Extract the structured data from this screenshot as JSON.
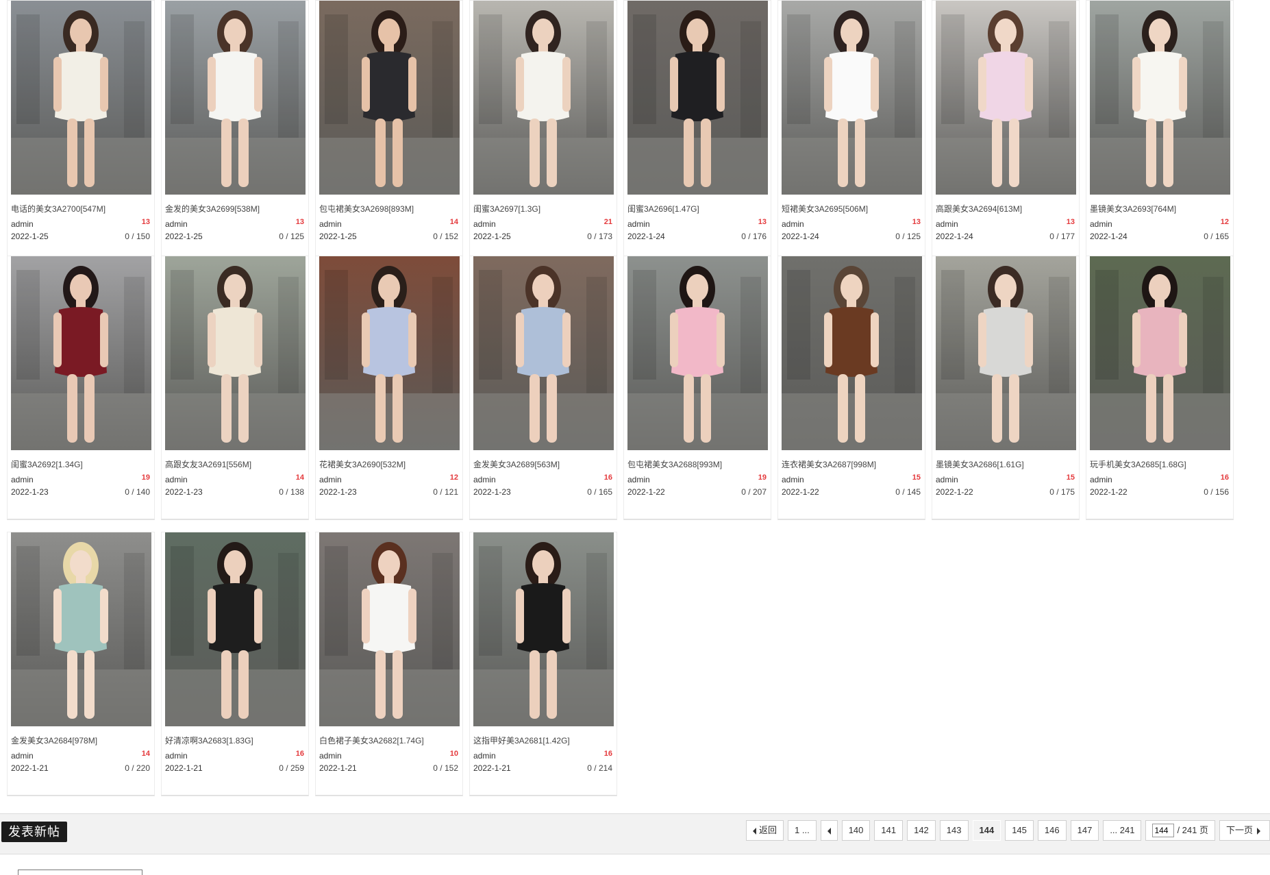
{
  "posts": [
    {
      "title": "电话的美女3A2700[547M]",
      "author": "admin",
      "replies": "13",
      "date": "2022-1-25",
      "views": "0 / 150"
    },
    {
      "title": "金发的美女3A2699[538M]",
      "author": "admin",
      "replies": "13",
      "date": "2022-1-25",
      "views": "0 / 125"
    },
    {
      "title": "包屯裙美女3A2698[893M]",
      "author": "admin",
      "replies": "14",
      "date": "2022-1-25",
      "views": "0 / 152"
    },
    {
      "title": "闺蜜3A2697[1.3G]",
      "author": "admin",
      "replies": "21",
      "date": "2022-1-25",
      "views": "0 / 173"
    },
    {
      "title": "闺蜜3A2696[1.47G]",
      "author": "admin",
      "replies": "13",
      "date": "2022-1-24",
      "views": "0 / 176"
    },
    {
      "title": "短裙美女3A2695[506M]",
      "author": "admin",
      "replies": "13",
      "date": "2022-1-24",
      "views": "0 / 125"
    },
    {
      "title": "高跟美女3A2694[613M]",
      "author": "admin",
      "replies": "13",
      "date": "2022-1-24",
      "views": "0 / 177"
    },
    {
      "title": "墨镜美女3A2693[764M]",
      "author": "admin",
      "replies": "12",
      "date": "2022-1-24",
      "views": "0 / 165"
    },
    {
      "title": "闺蜜3A2692[1.34G]",
      "author": "admin",
      "replies": "19",
      "date": "2022-1-23",
      "views": "0 / 140"
    },
    {
      "title": "高跟女友3A2691[556M]",
      "author": "admin",
      "replies": "14",
      "date": "2022-1-23",
      "views": "0 / 138"
    },
    {
      "title": "花裙美女3A2690[532M]",
      "author": "admin",
      "replies": "12",
      "date": "2022-1-23",
      "views": "0 / 121"
    },
    {
      "title": "金发美女3A2689[563M]",
      "author": "admin",
      "replies": "16",
      "date": "2022-1-23",
      "views": "0 / 165"
    },
    {
      "title": "包屯裙美女3A2688[993M]",
      "author": "admin",
      "replies": "19",
      "date": "2022-1-22",
      "views": "0 / 207"
    },
    {
      "title": "连衣裙美女3A2687[998M]",
      "author": "admin",
      "replies": "15",
      "date": "2022-1-22",
      "views": "0 / 145"
    },
    {
      "title": "墨镜美女3A2686[1.61G]",
      "author": "admin",
      "replies": "15",
      "date": "2022-1-22",
      "views": "0 / 175"
    },
    {
      "title": "玩手机美女3A2685[1.68G]",
      "author": "admin",
      "replies": "16",
      "date": "2022-1-22",
      "views": "0 / 156"
    },
    {
      "title": "金发美女3A2684[978M]",
      "author": "admin",
      "replies": "14",
      "date": "2022-1-21",
      "views": "0 / 220"
    },
    {
      "title": "好清凉啊3A2683[1.83G]",
      "author": "admin",
      "replies": "16",
      "date": "2022-1-21",
      "views": "0 / 259"
    },
    {
      "title": "白色裙子美女3A2682[1.74G]",
      "author": "admin",
      "replies": "10",
      "date": "2022-1-21",
      "views": "0 / 152"
    },
    {
      "title": "这指甲好美3A2681[1.42G]",
      "author": "admin",
      "replies": "16",
      "date": "2022-1-21",
      "views": "0 / 214"
    }
  ],
  "footer": {
    "new_post_label": "发表新帖",
    "pager": {
      "back_label": "返回",
      "first_label": "1 ...",
      "pages": [
        "140",
        "141",
        "142",
        "143",
        "144",
        "145",
        "146",
        "147"
      ],
      "current_page": "144",
      "last_label": "... 241",
      "input_value": "144",
      "total_label": "/ 241 页",
      "next_label": "下一页"
    }
  },
  "colors": {
    "replies": "#e4393c",
    "new_post_bg": "#1c1c1c"
  }
}
